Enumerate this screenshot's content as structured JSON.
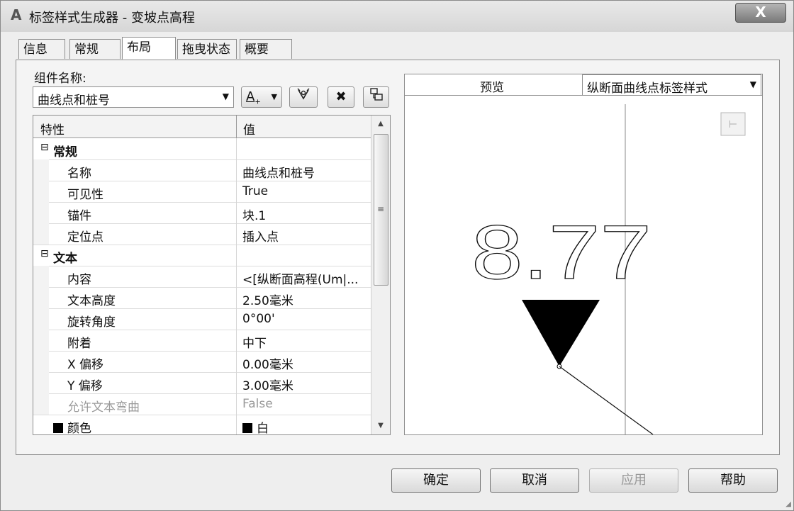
{
  "window": {
    "title": "标签样式生成器 - 变坡点高程",
    "close_glyph": "X",
    "app_icon": "autocad-a-icon"
  },
  "tabs": [
    {
      "label": "信息",
      "active": false
    },
    {
      "label": "常规",
      "active": false
    },
    {
      "label": "布局",
      "active": true
    },
    {
      "label": "拖曳状态",
      "active": false
    },
    {
      "label": "概要",
      "active": false
    }
  ],
  "component": {
    "label": "组件名称:",
    "selected": "曲线点和桩号",
    "tools": [
      "create-text-component-icon",
      "copy-component-icon",
      "delete-component-icon",
      "component-draw-order-icon"
    ],
    "text_tool_glyph": "A"
  },
  "properties": {
    "columns": [
      "特性",
      "值"
    ],
    "rows": [
      {
        "type": "category",
        "name": "常规",
        "toggle": "⊟"
      },
      {
        "type": "item",
        "name": "名称",
        "value": "曲线点和桩号"
      },
      {
        "type": "item",
        "name": "可见性",
        "value": "True"
      },
      {
        "type": "item",
        "name": "锚件",
        "value": "块.1"
      },
      {
        "type": "item",
        "name": "定位点",
        "value": "插入点"
      },
      {
        "type": "category",
        "name": "文本",
        "toggle": "⊟"
      },
      {
        "type": "item",
        "name": "内容",
        "value": "<[纵断面高程(Um|..."
      },
      {
        "type": "item",
        "name": "文本高度",
        "value": "2.50毫米"
      },
      {
        "type": "item",
        "name": "旋转角度",
        "value": "0°00'"
      },
      {
        "type": "item",
        "name": "附着",
        "value": "中下"
      },
      {
        "type": "item",
        "name": "X 偏移",
        "value": "0.00毫米"
      },
      {
        "type": "item",
        "name": "Y 偏移",
        "value": "3.00毫米"
      },
      {
        "type": "item",
        "name": "允许文本弯曲",
        "value": "False",
        "disabled": true
      },
      {
        "type": "color",
        "name": "颜色",
        "value": "白",
        "swatch": "#000000"
      }
    ]
  },
  "preview": {
    "label": "预览",
    "style_selected": "纵断面曲线点标签样式",
    "sample_text": "8.77",
    "marker_color": "#000000"
  },
  "buttons": {
    "ok": "确定",
    "cancel": "取消",
    "apply": "应用",
    "help": "帮助"
  }
}
